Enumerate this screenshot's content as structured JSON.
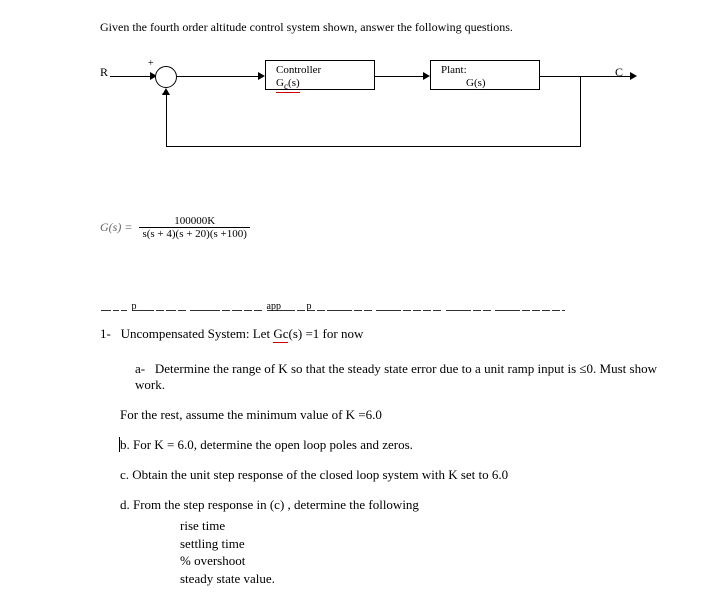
{
  "title": "Given the fourth order altitude control system shown, answer the following questions.",
  "diagram": {
    "r": "R",
    "c": "C",
    "plus": "+",
    "minus": "-",
    "controller": {
      "title": "Controller",
      "tf": "G",
      "sub": "c",
      "arg": "(s)"
    },
    "plant": {
      "title": "Plant:",
      "tf": "G(s)"
    }
  },
  "equation": {
    "lhs": "G(s) =",
    "num": "100000K",
    "den": "s(s + 4)(s + 20)(s +100)"
  },
  "partial_line": "… plots must have appropriate labels and titles.",
  "q1": {
    "num": "1-",
    "text": "Uncompensated System:  Let ",
    "gc": "Gc",
    "after": "(s) =1 for now"
  },
  "a": {
    "num": "a-",
    "text": "Determine the range of K so that the steady state error due to a unit ramp input is ≤0. Must show work."
  },
  "min_k": "For the rest, assume the minimum value of K =6.0",
  "b": {
    "num": "b.",
    "text": " For K = 6.0, determine the open loop poles and zeros."
  },
  "c": {
    "num": "c.",
    "text": " Obtain the unit step response of the closed loop system with K set to 6.0"
  },
  "d": {
    "num": "d.",
    "text": " From the step response in (c) , determine the following",
    "items": [
      "rise time",
      "settling time",
      "% overshoot",
      "steady state value."
    ]
  }
}
